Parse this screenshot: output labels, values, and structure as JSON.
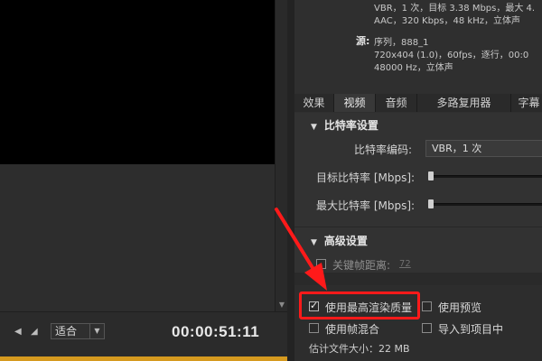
{
  "preview": {
    "fit_option": "适合",
    "timecode": "00:00:51:11"
  },
  "summary": {
    "line1": "VBR，1 次，目标 3.38 Mbps，最大 4.",
    "line2": "AAC，320 Kbps，48 kHz，立体声",
    "source_key": "源:",
    "source_line1": "序列，888_1",
    "source_line2": "720x404 (1.0)，60fps，逐行，00:0",
    "source_line3": "48000 Hz，立体声"
  },
  "tabs": [
    {
      "label": "效果"
    },
    {
      "label": "视频"
    },
    {
      "label": "音频"
    },
    {
      "label": "多路复用器"
    },
    {
      "label": "字幕"
    }
  ],
  "bitrate": {
    "section_title": "比特率设置",
    "encoding_label": "比特率编码:",
    "encoding_value": "VBR，1 次",
    "target_label": "目标比特率 [Mbps]:",
    "max_label": "最大比特率 [Mbps]:"
  },
  "advanced": {
    "section_title": "高级设置",
    "keyframe_label": "关键帧距离:",
    "keyframe_value": "72"
  },
  "options": {
    "max_quality": "使用最高渲染质量",
    "use_preview": "使用预览",
    "frame_blend": "使用帧混合",
    "import_project": "导入到项目中",
    "estimate": "估计文件大小：22 MB"
  },
  "colors": {
    "highlight": "#ff1a1a",
    "timeline_bar": "#d69a1f"
  }
}
